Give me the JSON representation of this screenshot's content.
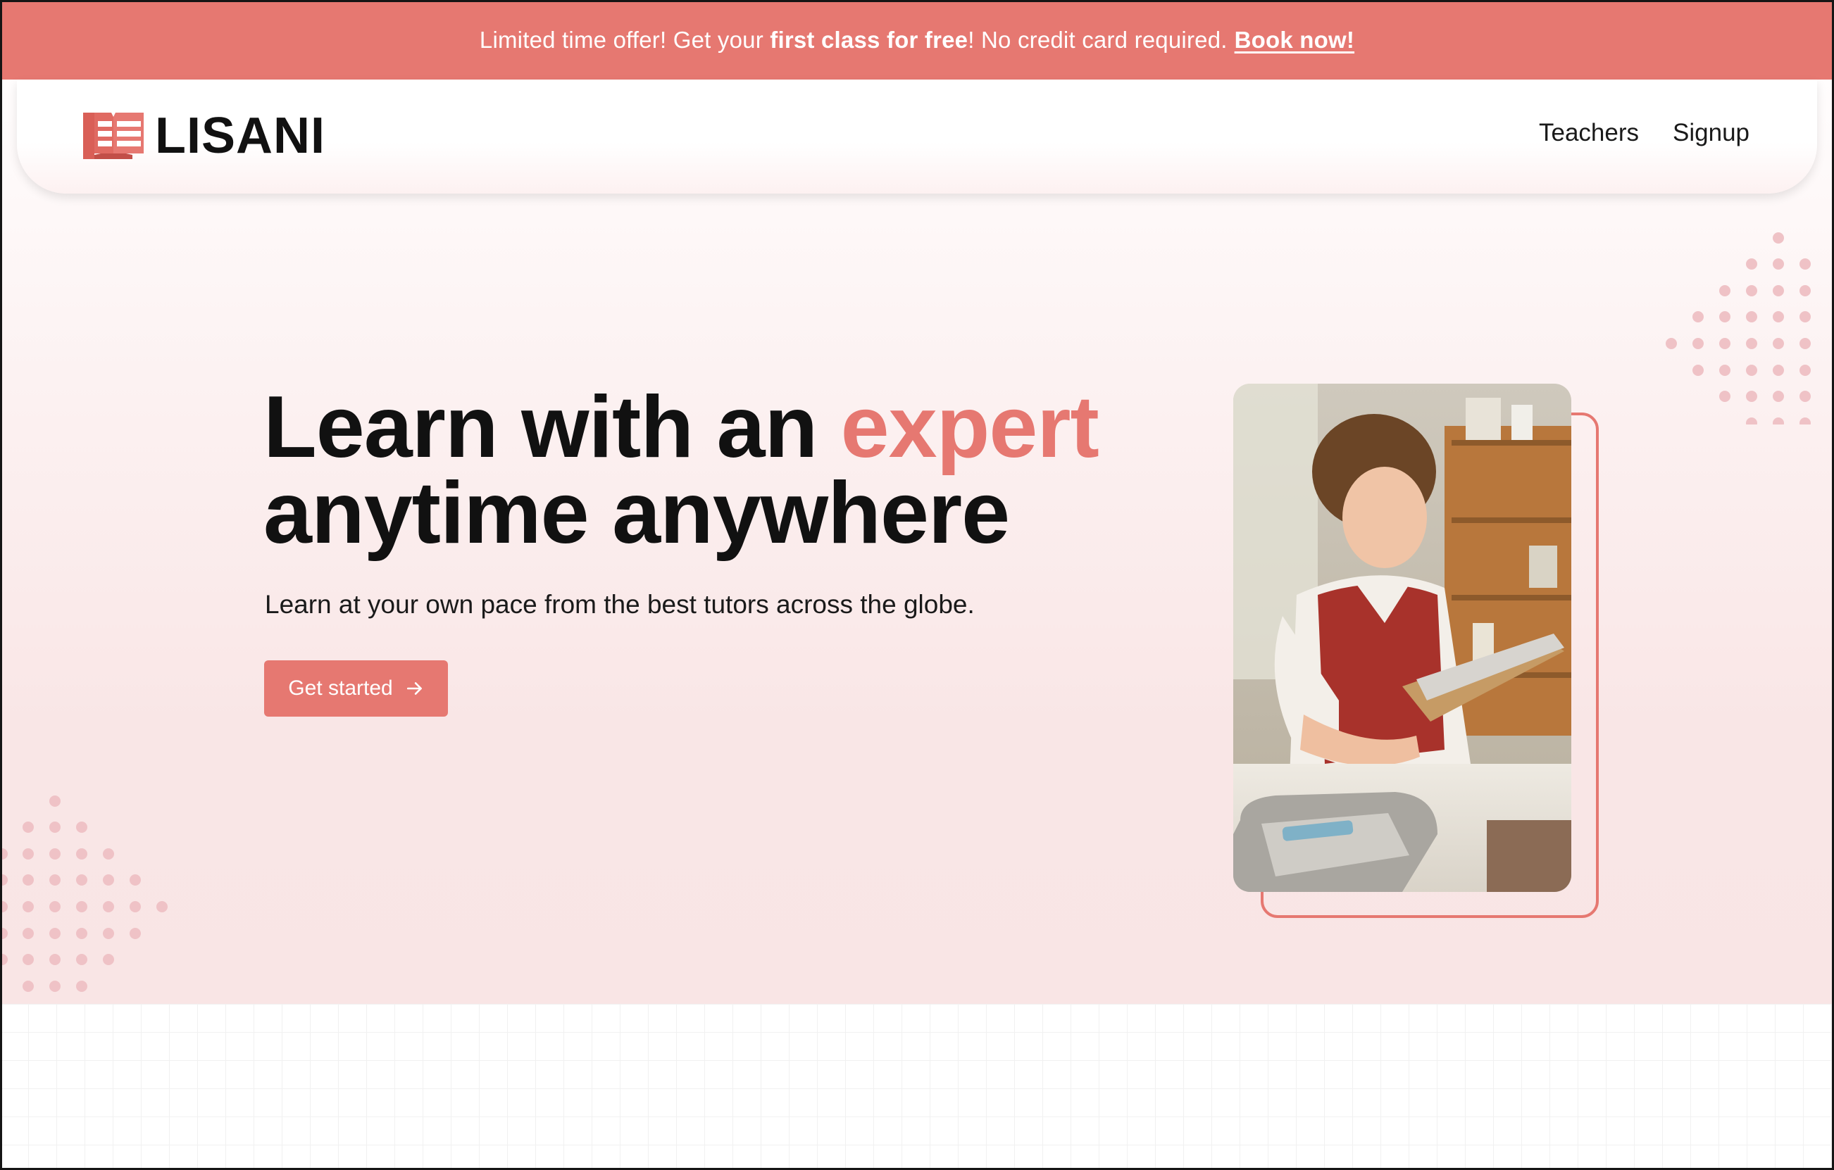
{
  "promo": {
    "text_before": "Limited time offer! Get your",
    "text_strong": "first class for free",
    "text_after": "! No credit card required.",
    "link_label": "Book now!"
  },
  "header": {
    "brand": "LISANI",
    "logo_icon": "open-book-icon",
    "nav": [
      {
        "label": "Teachers"
      },
      {
        "label": "Signup"
      }
    ]
  },
  "hero": {
    "headline_part1": "Learn with an",
    "headline_accent": "expert",
    "headline_line2": "anytime anywhere",
    "subtitle": "Learn at your own pace from the best tutors across the globe.",
    "cta_label": "Get started",
    "cta_icon": "arrow-right-icon"
  },
  "colors": {
    "accent": "#e67871",
    "text": "#111111",
    "dots": "#efc2c6"
  }
}
